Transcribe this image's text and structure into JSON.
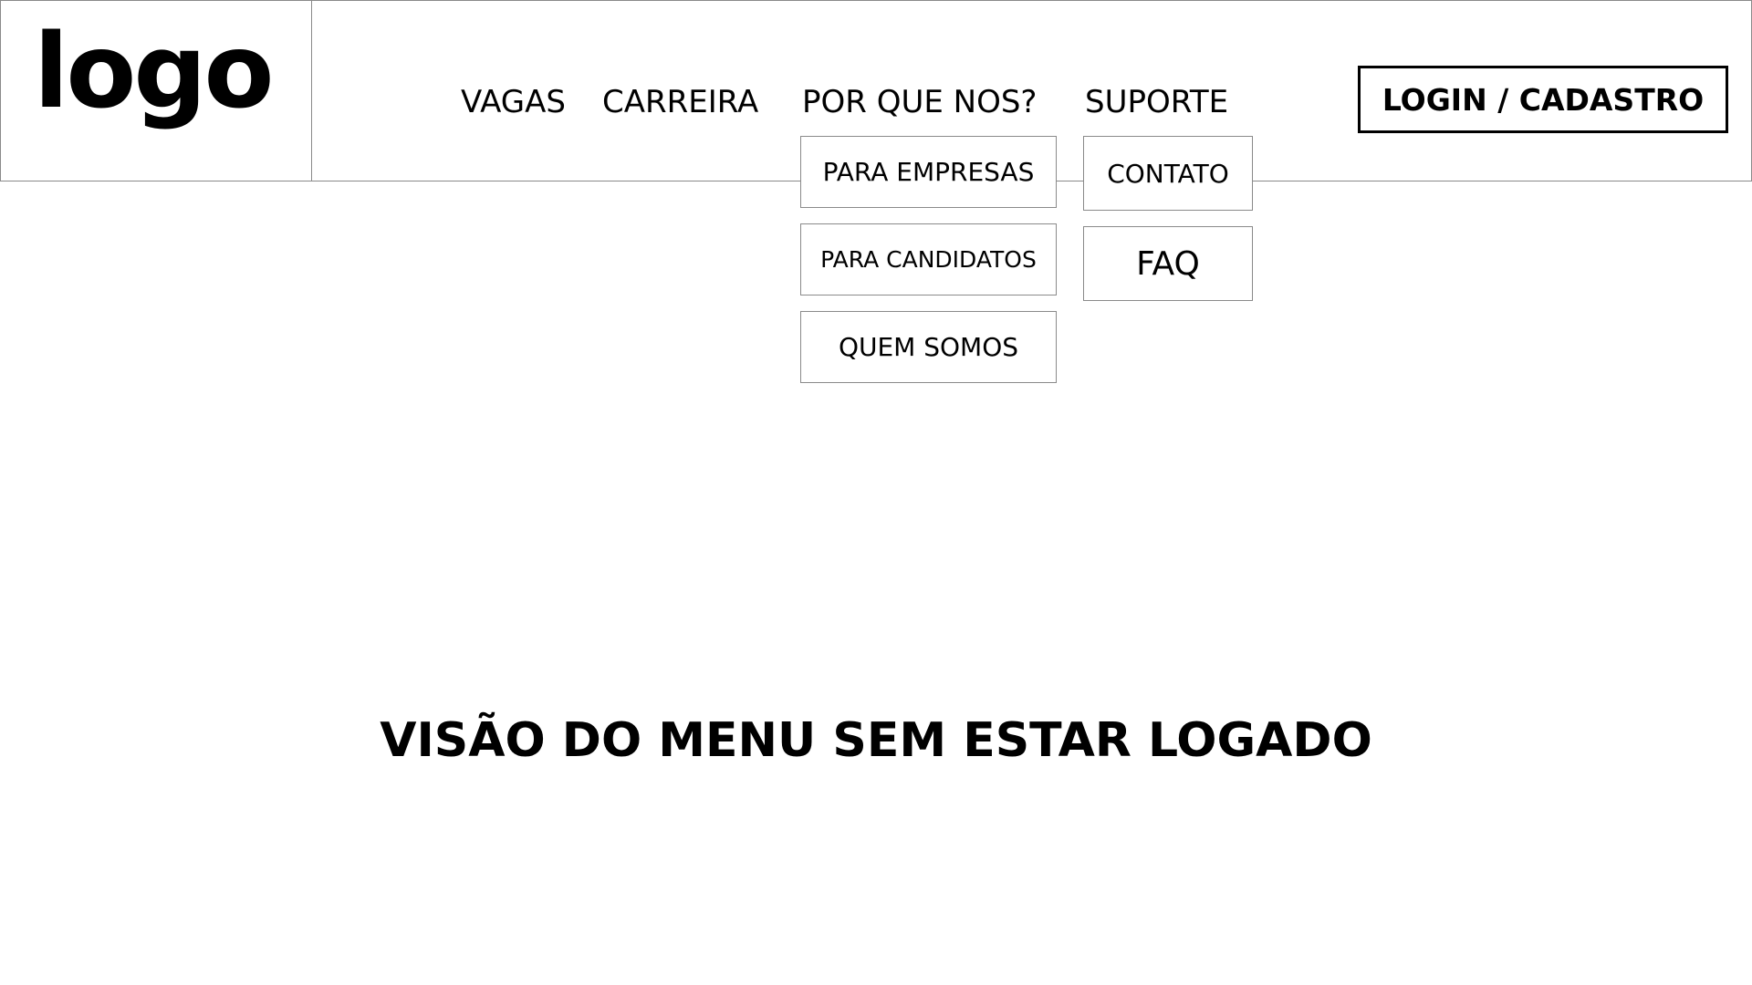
{
  "header": {
    "logo_text": "logo",
    "nav": {
      "vagas": "VAGAS",
      "carreira": "CARREIRA",
      "por_que_nos": "POR QUE NOS?",
      "suporte": "SUPORTE"
    },
    "login_label": "LOGIN / CADASTRO"
  },
  "dropdowns": {
    "por_que_nos": {
      "items": [
        "PARA EMPRESAS",
        "PARA CANDIDATOS",
        "QUEM SOMOS"
      ]
    },
    "suporte": {
      "items": [
        "CONTATO",
        "FAQ"
      ]
    }
  },
  "caption": "VISÃO DO MENU SEM ESTAR LOGADO"
}
